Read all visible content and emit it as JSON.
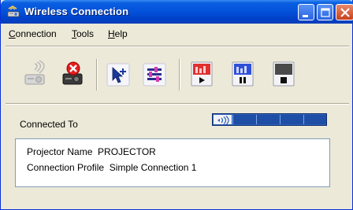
{
  "window": {
    "title": "Wireless Connection"
  },
  "menu": {
    "connection": {
      "underline": "C",
      "rest": "onnection"
    },
    "tools": {
      "underline": "T",
      "rest": "ools"
    },
    "help": {
      "underline": "H",
      "rest": "elp"
    }
  },
  "toolbar": {
    "buttons": [
      {
        "icon": "projector-connect-icon",
        "enabled": false
      },
      {
        "icon": "projector-disconnect-icon",
        "enabled": true
      },
      {
        "icon": "pointer-add-icon",
        "enabled": true
      },
      {
        "icon": "settings-sliders-icon",
        "enabled": true
      },
      {
        "icon": "screen-play-icon",
        "enabled": true
      },
      {
        "icon": "screen-pause-icon",
        "enabled": true
      },
      {
        "icon": "stop-icon",
        "enabled": true
      }
    ]
  },
  "status": {
    "connected_to_label": "Connected To",
    "signal_level": 1.0
  },
  "info": {
    "projector_name_label": "Projector Name",
    "projector_name_value": "PROJECTOR",
    "connection_profile_label": "Connection Profile",
    "connection_profile_value": "Simple Connection 1"
  },
  "colors": {
    "titlebar": "#0453db",
    "close_button": "#c8401c",
    "signal_bar": "#2d62b8"
  }
}
